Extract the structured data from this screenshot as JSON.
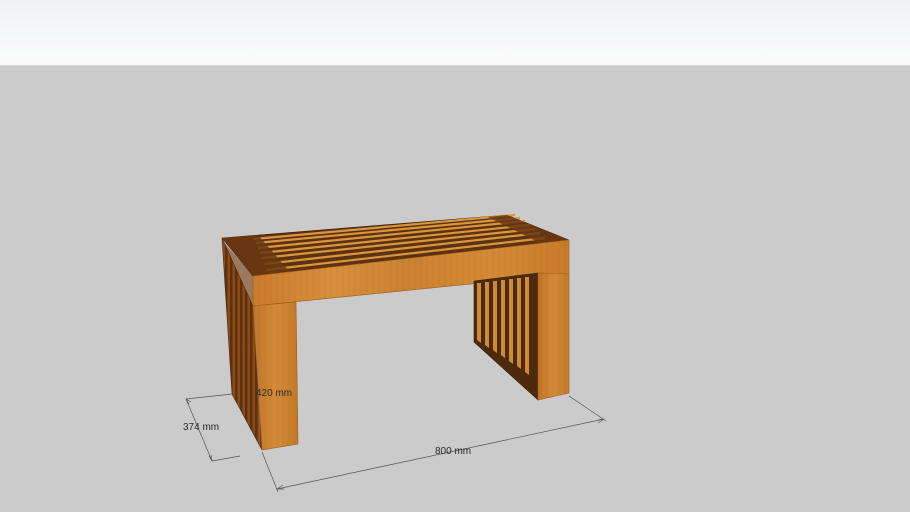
{
  "scene": {
    "model": "wooden-bench",
    "colors": {
      "sky_top": "#eef0f2",
      "ground": "#cbcbcb",
      "wood_light": "#d08c38",
      "wood_mid": "#c77a2a",
      "wood_dark": "#6e3c12",
      "dimension_line": "#555555"
    }
  },
  "dimensions": {
    "height": "420 mm",
    "depth": "374 mm",
    "width": "800 mm"
  }
}
